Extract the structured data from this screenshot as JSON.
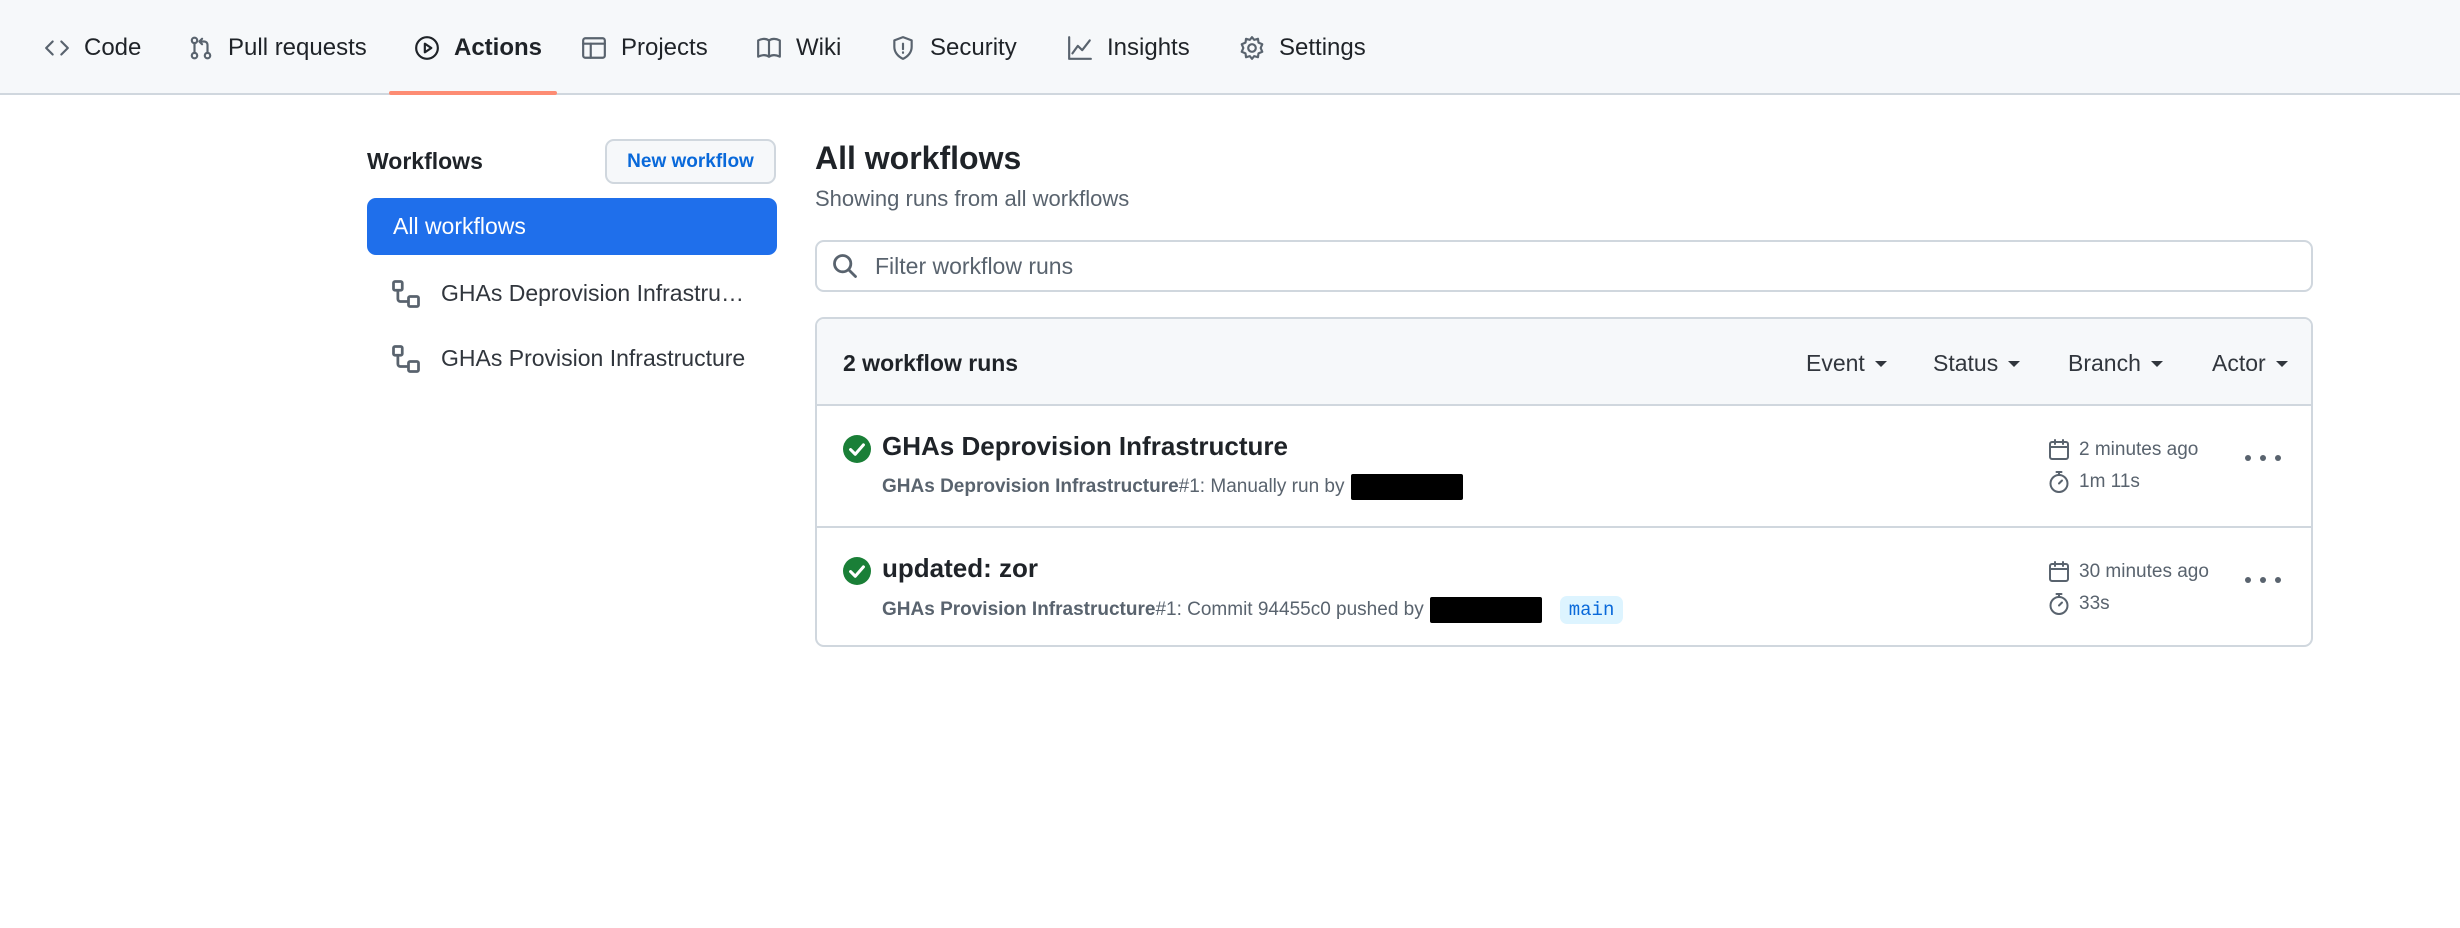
{
  "repo_nav": {
    "tabs": [
      {
        "label": "Code",
        "icon": "code-icon",
        "active": false
      },
      {
        "label": "Pull requests",
        "icon": "pull-request-icon",
        "active": false
      },
      {
        "label": "Actions",
        "icon": "play-icon",
        "active": true
      },
      {
        "label": "Projects",
        "icon": "table-icon",
        "active": false
      },
      {
        "label": "Wiki",
        "icon": "book-icon",
        "active": false
      },
      {
        "label": "Security",
        "icon": "shield-icon",
        "active": false
      },
      {
        "label": "Insights",
        "icon": "graph-icon",
        "active": false
      },
      {
        "label": "Settings",
        "icon": "gear-icon",
        "active": false
      }
    ],
    "active_underline_color": "#fd8c73"
  },
  "sidebar": {
    "heading": "Workflows",
    "new_workflow_label": "New workflow",
    "items": [
      {
        "label": "All workflows",
        "active": true
      },
      {
        "label": "GHAs Deprovision Infrastructure",
        "icon": "workflow-icon"
      },
      {
        "label": "GHAs Provision Infrastructure",
        "icon": "workflow-icon"
      }
    ],
    "active_color": "#1f6feb"
  },
  "main": {
    "title": "All workflows",
    "subtitle": "Showing runs from all workflows",
    "filter_placeholder": "Filter workflow runs",
    "filter_value": "",
    "runs_count": "2 workflow runs",
    "filters": [
      "Event",
      "Status",
      "Branch",
      "Actor"
    ],
    "runs": [
      {
        "status": "success",
        "title": "GHAs Deprovision Infrastructure",
        "workflow": "GHAs Deprovision Infrastructure",
        "meta": " #1: Manually run by",
        "branch": "",
        "when": "2 minutes ago",
        "duration": "1m 11s"
      },
      {
        "status": "success",
        "title": "updated: zor",
        "workflow": "GHAs Provision Infrastructure",
        "meta": " #1: Commit 94455c0 pushed by",
        "branch": "main",
        "when": "30 minutes ago",
        "duration": "33s"
      }
    ],
    "success_color": "#1a7f37"
  }
}
